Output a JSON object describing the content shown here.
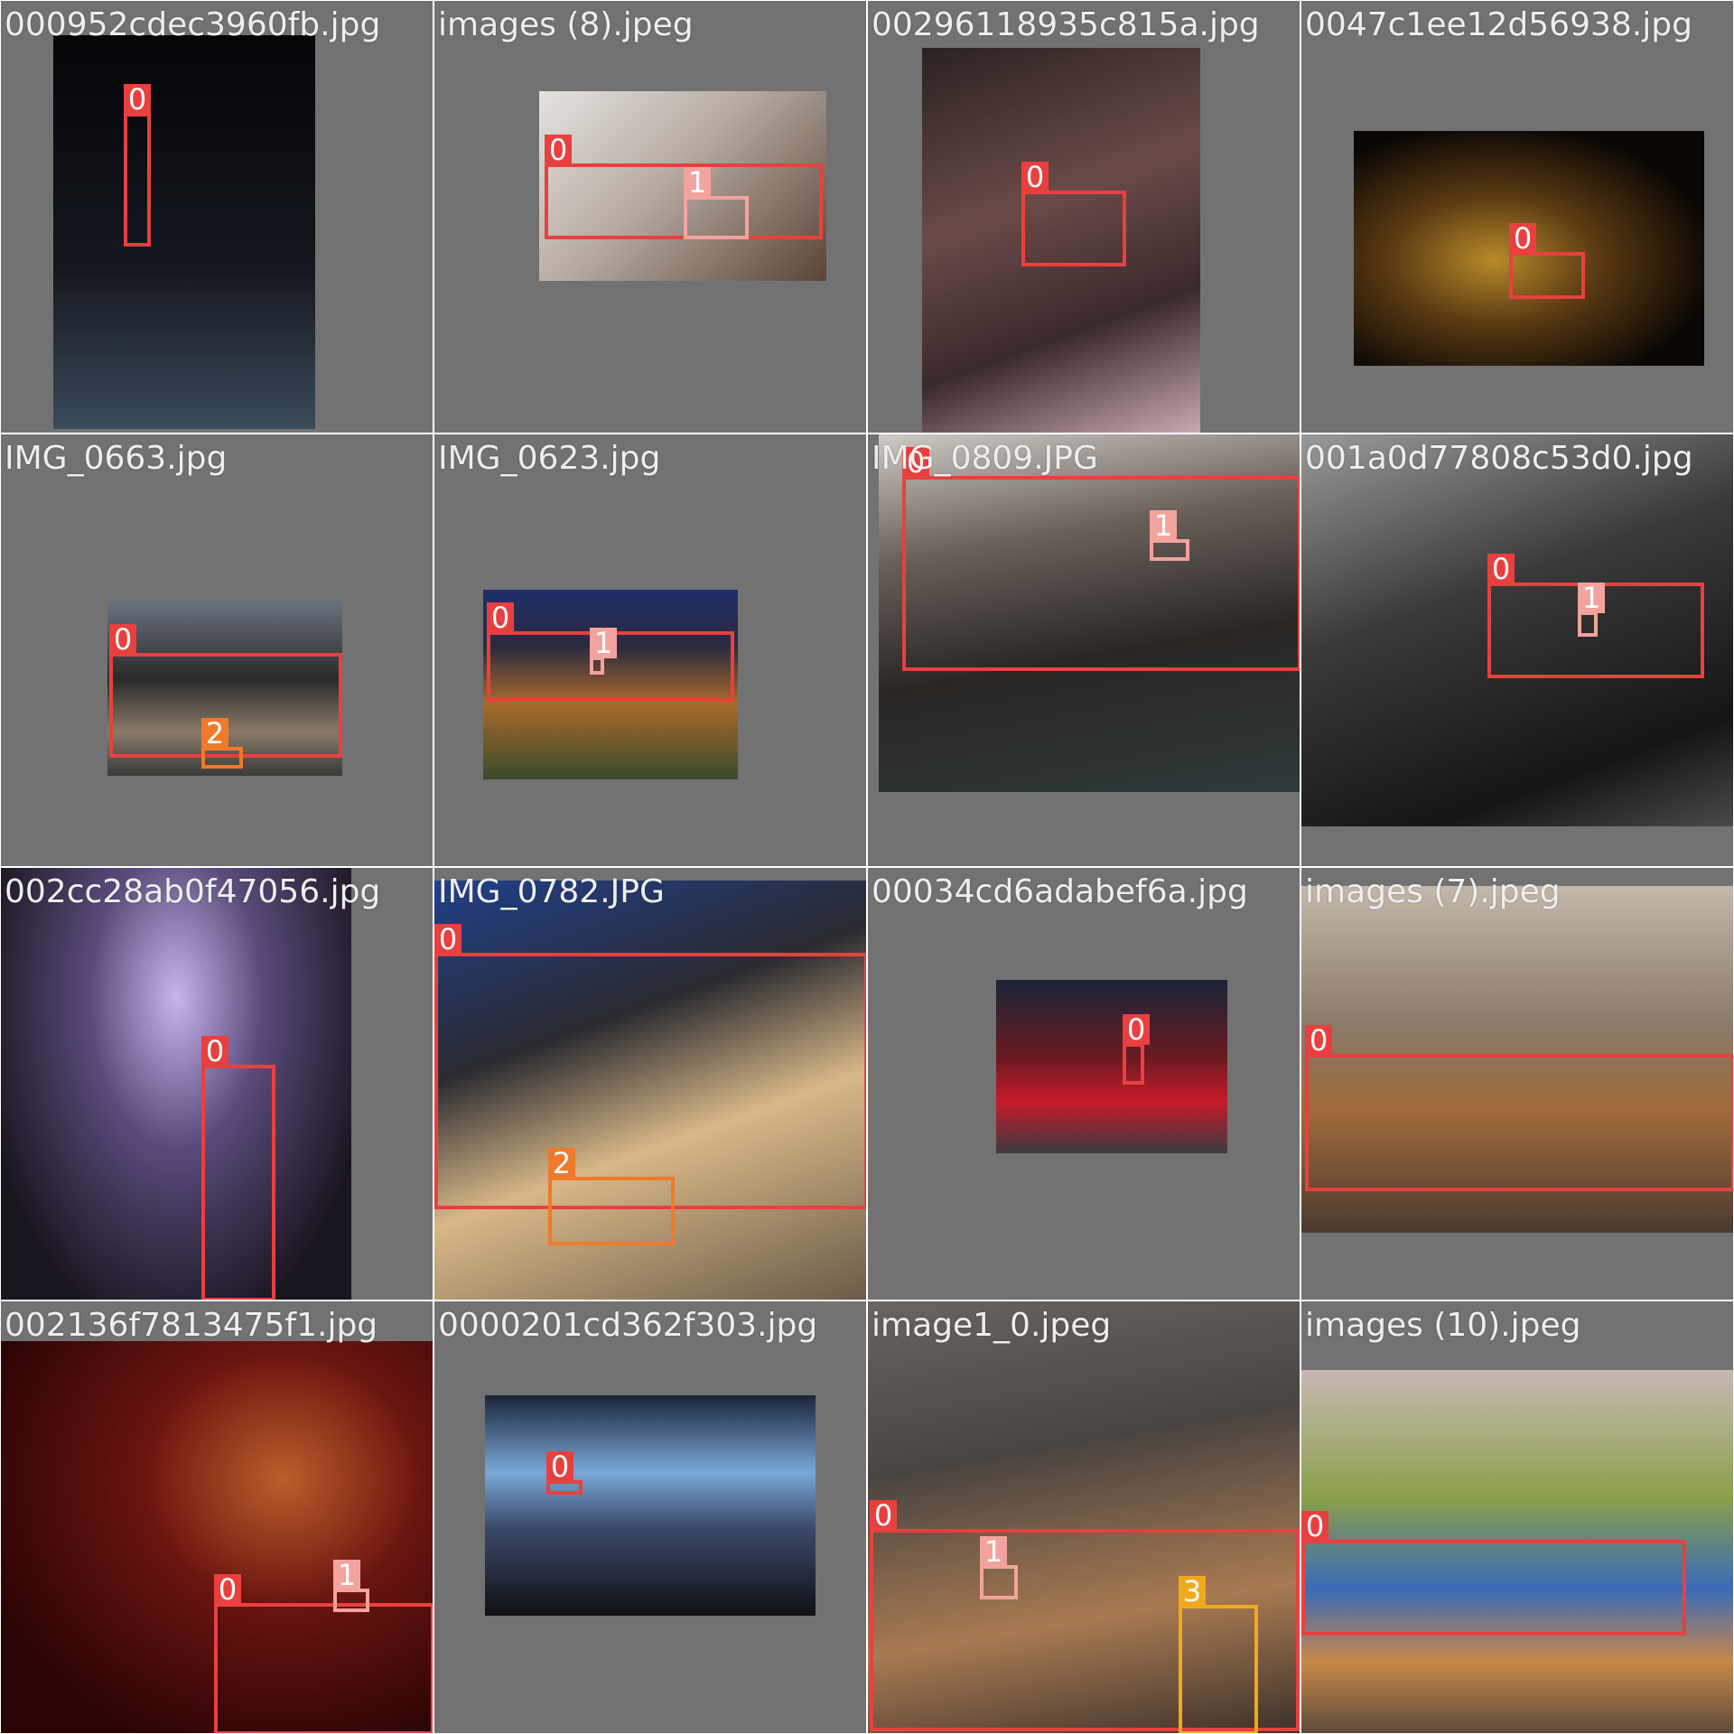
{
  "grid": {
    "tiles": [
      {
        "filename": "000952cdec3960fb.jpg",
        "bg": "#0a0a0c",
        "boxes": [
          "0"
        ]
      },
      {
        "filename": "images (8).jpeg",
        "bg": "#8c8279",
        "boxes": [
          "0",
          "1"
        ]
      },
      {
        "filename": "00296118935c815a.jpg",
        "bg": "#4a3a36",
        "boxes": [
          "0"
        ]
      },
      {
        "filename": "0047c1ee12d56938.jpg",
        "bg": "#1c140c",
        "boxes": [
          "0"
        ]
      },
      {
        "filename": "IMG_0663.jpg",
        "bg": "#3f3c3a",
        "boxes": [
          "0",
          "2"
        ]
      },
      {
        "filename": "IMG_0623.jpg",
        "bg": "#3a3040",
        "boxes": [
          "0",
          "1"
        ]
      },
      {
        "filename": "IMG_0809.JPG",
        "bg": "#3e3a36",
        "boxes": [
          "0",
          "1"
        ]
      },
      {
        "filename": "001a0d77808c53d0.jpg",
        "bg": "#3a3a3a",
        "boxes": [
          "0",
          "1"
        ]
      },
      {
        "filename": "002cc28ab0f47056.jpg",
        "bg": "#2a2236",
        "boxes": [
          "0"
        ]
      },
      {
        "filename": "IMG_0782.JPG",
        "bg": "#3a4350",
        "boxes": [
          "0",
          "2"
        ]
      },
      {
        "filename": "00034cd6adabef6a.jpg",
        "bg": "#2a1a20",
        "boxes": [
          "0"
        ]
      },
      {
        "filename": "images (7).jpeg",
        "bg": "#8e7e6e",
        "boxes": [
          "0"
        ]
      },
      {
        "filename": "002136f7813475f1.jpg",
        "bg": "#3a0808",
        "boxes": [
          "0",
          "1"
        ]
      },
      {
        "filename": "0000201cd362f303.jpg",
        "bg": "#2a3a50",
        "boxes": [
          "0"
        ]
      },
      {
        "filename": "image1_0.jpeg",
        "bg": "#3c3836",
        "boxes": [
          "0",
          "1",
          "3"
        ]
      },
      {
        "filename": "images (10).jpeg",
        "bg": "#6a7a4a",
        "boxes": [
          "0"
        ]
      }
    ]
  },
  "colors": {
    "tile_background": "#727272",
    "class_0": "#e8403f",
    "class_1": "#f3a39d",
    "class_2": "#ef7a2c",
    "class_3": "#f0a91d"
  }
}
